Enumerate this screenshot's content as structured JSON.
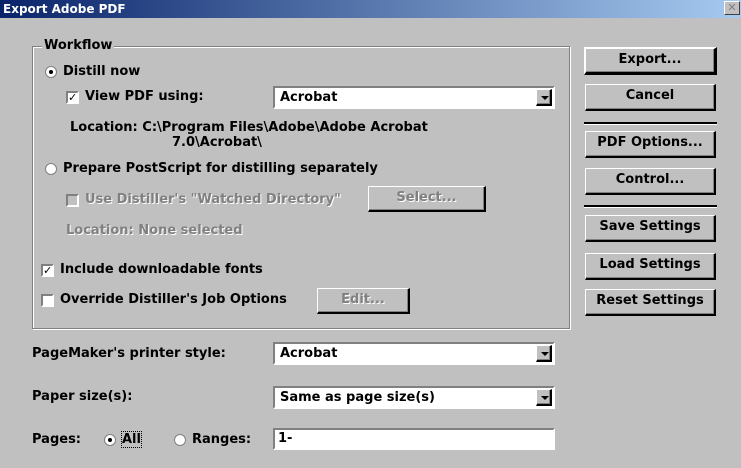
{
  "window": {
    "title": "Export Adobe PDF",
    "close_glyph": "✕"
  },
  "workflow": {
    "legend": "Workflow",
    "distill_now": "Distill now",
    "view_pdf_label": "View PDF using:",
    "viewer_value": "Acrobat",
    "location_line1": "Location: C:\\Program Files\\Adobe\\Adobe Acrobat",
    "location_line2": "7.0\\Acrobat\\",
    "prepare_postscript": "Prepare PostScript for distilling separately",
    "use_watched_dir": "Use Distiller's \"Watched Directory\"",
    "select_button": "Select...",
    "location_none": "Location:   None selected",
    "include_fonts": "Include downloadable fonts",
    "override_job_options": "Override Distiller's Job Options",
    "edit_button": "Edit..."
  },
  "printer_style": {
    "label": "PageMaker's printer style:",
    "value": "Acrobat"
  },
  "paper_size": {
    "label": "Paper size(s):",
    "value": "Same as page size(s)"
  },
  "pages": {
    "label": "Pages:",
    "all_label": "All",
    "ranges_label": "Ranges:",
    "ranges_value": "1-"
  },
  "buttons": {
    "export": "Export...",
    "cancel": "Cancel",
    "pdf_options": "PDF Options...",
    "control": "Control...",
    "save_settings": "Save Settings",
    "load_settings": "Load Settings",
    "reset_settings": "Reset Settings"
  },
  "state": {
    "distill_now_selected": true,
    "view_pdf_checked": true,
    "include_fonts_checked": true,
    "override_checked": false,
    "pages_all_selected": true
  }
}
